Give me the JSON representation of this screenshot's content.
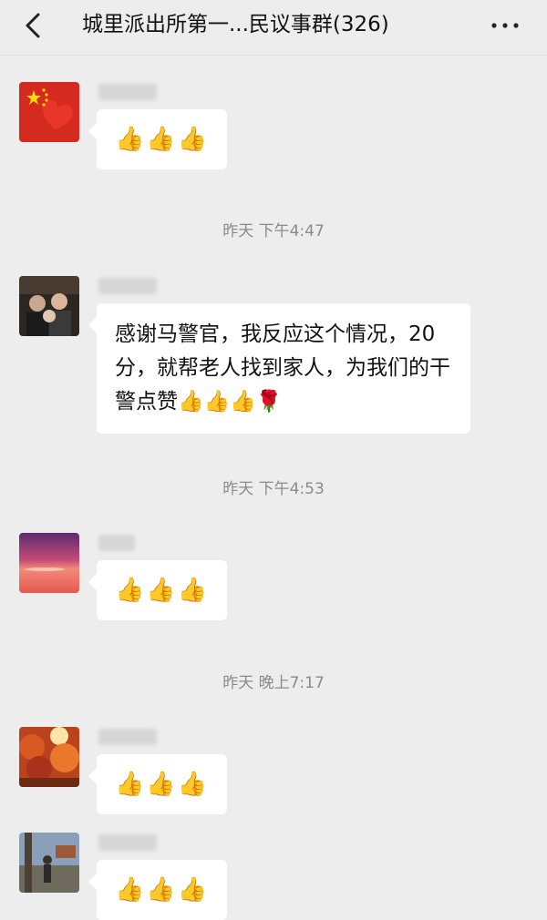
{
  "header": {
    "title": "城里派出所第一...民议事群(326)"
  },
  "messages": [
    {
      "text": "👍👍👍"
    },
    {
      "text": "感谢马警官，我反应这个情况，20 分，就帮老人找到家人，为我们的干警点赞👍👍👍🌹"
    },
    {
      "text": "👍👍👍"
    },
    {
      "text": "👍👍👍"
    },
    {
      "text": "👍👍👍"
    }
  ],
  "timestamps": [
    "昨天 下午4:47",
    "昨天 下午4:53",
    "昨天 晚上7:17"
  ]
}
